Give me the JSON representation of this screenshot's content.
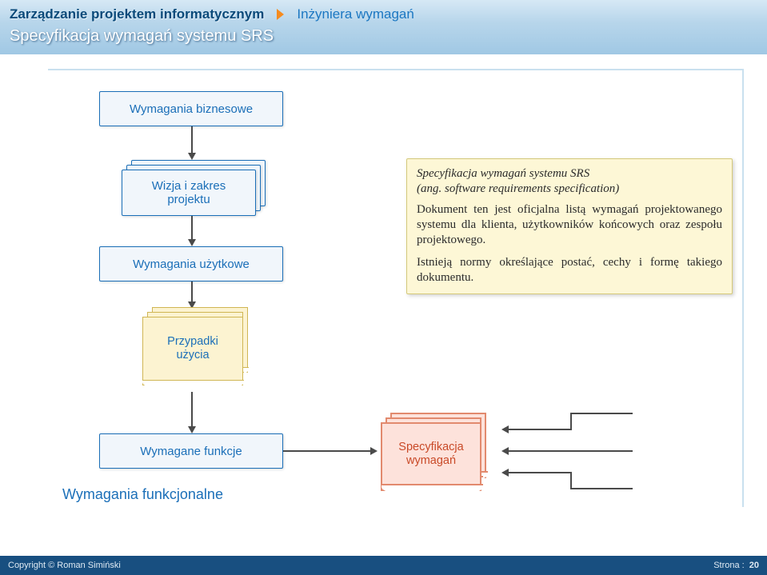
{
  "header": {
    "breadcrumb_main": "Zarządzanie projektem informatycznym",
    "breadcrumb_sub": "Inżyniera wymagań",
    "title": "Specyfikacja wymagań systemu SRS"
  },
  "diagram": {
    "business_req": "Wymagania biznesowe",
    "vision_scope_l1": "Wizja i zakres",
    "vision_scope_l2": "projektu",
    "usage_req": "Wymagania użytkowe",
    "use_cases_l1": "Przypadki",
    "use_cases_l2": "użycia",
    "required_functions": "Wymagane funkcje",
    "spec_l1": "Specyfikacja",
    "spec_l2": "wymagań",
    "functional_req": "Wymagania funkcjonalne"
  },
  "note": {
    "title_text": "Specyfikacja wymagań systemu SRS",
    "subtitle": "(ang. software requirements specification)",
    "p1": "Dokument ten jest oficjalna listą wymagań projektowanego systemu dla klienta, użytkowników końcowych oraz zespołu projektowego.",
    "p2": "Istnieją normy określające postać, cechy i formę takiego dokumentu."
  },
  "footer": {
    "copyright": "Copyright © Roman Simiński",
    "page_label": "Strona :",
    "page_num": "20"
  }
}
